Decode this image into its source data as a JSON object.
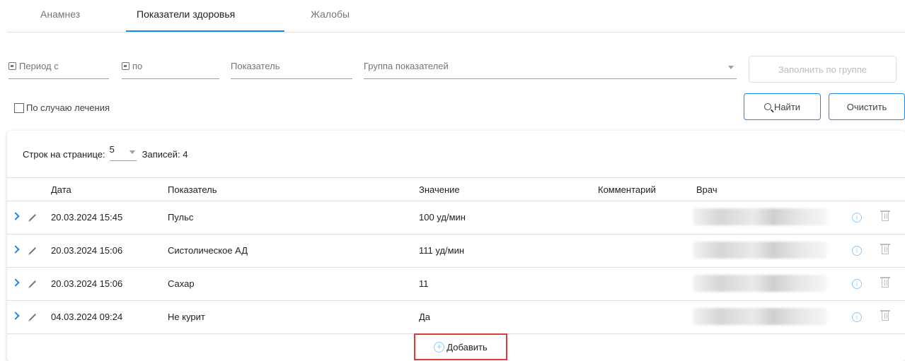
{
  "tabs": [
    {
      "label": "Анамнез",
      "active": false
    },
    {
      "label": "Показатели здоровья",
      "active": true
    },
    {
      "label": "Жалобы",
      "active": false
    }
  ],
  "filters": {
    "period_from_label": "Период с",
    "period_to_label": "по",
    "indicator_label": "Показатель",
    "group_label": "Группа показателей",
    "fill_by_group_label": "Заполнить по группе",
    "treatment_case_label": "По случаю лечения",
    "find_label": "Найти",
    "clear_label": "Очистить"
  },
  "table": {
    "rows_per_page_label": "Строк на странице:",
    "rows_per_page_value": "5",
    "records_label": "Записей:",
    "records_count": "4",
    "columns": [
      "Дата",
      "Показатель",
      "Значение",
      "Комментарий",
      "Врач"
    ],
    "rows": [
      {
        "date": "20.03.2024 15:45",
        "indicator": "Пульс",
        "value": "100 уд/мин",
        "comment": ""
      },
      {
        "date": "20.03.2024 15:06",
        "indicator": "Систолическое АД",
        "value": "111 уд/мин",
        "comment": ""
      },
      {
        "date": "20.03.2024 15:06",
        "indicator": "Сахар",
        "value": "11",
        "comment": ""
      },
      {
        "date": "04.03.2024 09:24",
        "indicator": "Не курит",
        "value": "Да",
        "comment": ""
      }
    ],
    "add_label": "Добавить",
    "info_glyph": "i"
  },
  "colors": {
    "accent": "#1e88e5",
    "highlight": "#e53935"
  }
}
